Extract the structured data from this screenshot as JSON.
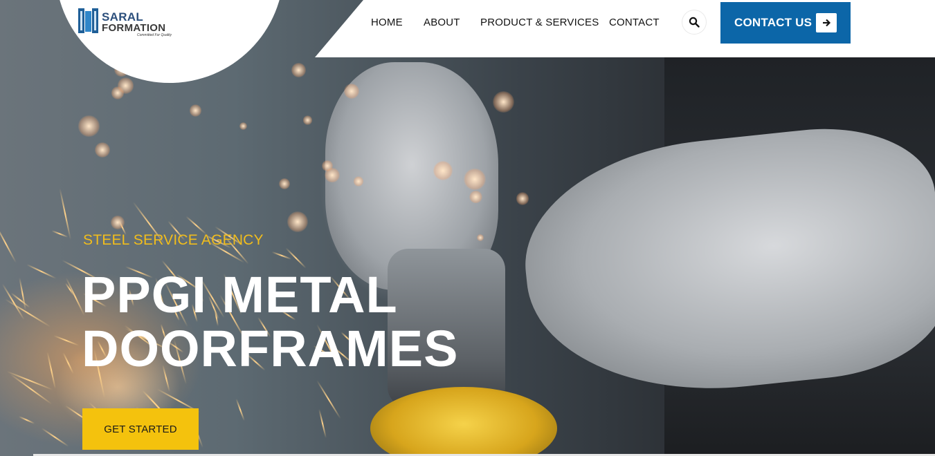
{
  "brand": {
    "name_line1": "SARAL",
    "name_line2": "FORMATION",
    "tagline": "Committed For Quality",
    "colors": {
      "primary_blue": "#0c66a8",
      "logo_blue": "#2c4f7c",
      "accent_yellow": "#f4c20d",
      "eyebrow_gold": "#f1bd1c"
    }
  },
  "nav": {
    "items": [
      {
        "label": "HOME"
      },
      {
        "label": "ABOUT"
      },
      {
        "label": "PRODUCT & SERVICES"
      },
      {
        "label": "CONTACT"
      }
    ],
    "search_icon": "search-icon",
    "cta_label": "CONTACT US",
    "cta_icon": "arrow-right-icon"
  },
  "hero": {
    "eyebrow": "STEEL SERVICE AGENCY",
    "headline_line1": "PPGI METAL",
    "headline_line2": "DOORFRAMES",
    "button_label": "GET STARTED",
    "image": "worker-grinding-metal-sparks"
  }
}
